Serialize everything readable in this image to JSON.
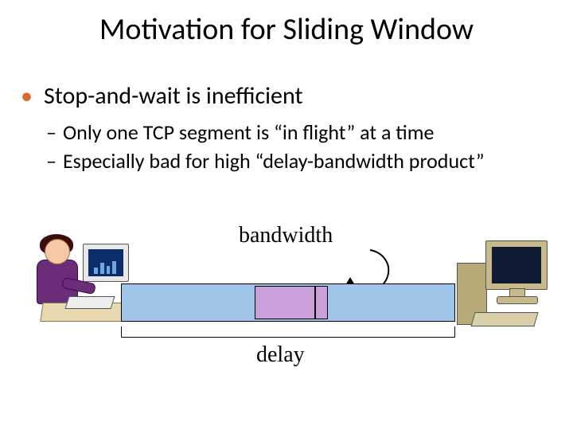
{
  "title": "Motivation for Sliding Window",
  "bullets": {
    "main": "Stop-and-wait is inefficient",
    "sub": [
      "Only one TCP segment is “in flight” at a time",
      "Especially bad for high “delay-bandwidth product”"
    ]
  },
  "diagram": {
    "bandwidth_label": "bandwidth",
    "delay_label": "delay"
  }
}
